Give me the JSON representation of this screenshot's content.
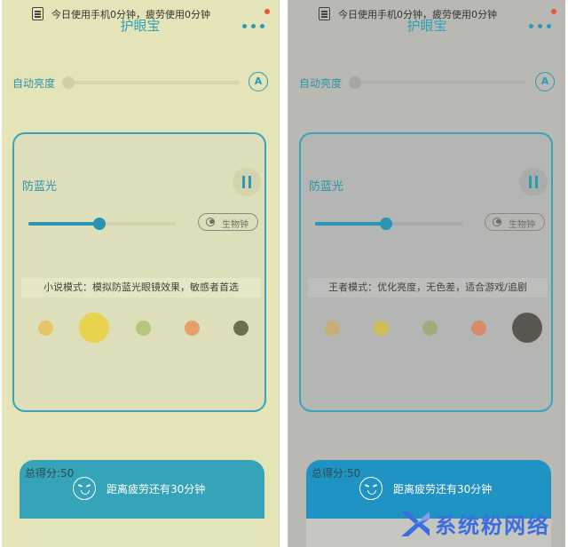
{
  "screens": [
    {
      "id": "left",
      "title": "护眼宝",
      "auto_brightness_label": "自动亮度",
      "auto_button": "A",
      "card_title": "防蓝光",
      "blue_light_level": 0.48,
      "circadian_label": "生物钟",
      "mode_text": "小说模式：模拟防蓝光眼镜效果，敏感者首选",
      "selected_dot": 1,
      "score": "总得分:50",
      "fatigue_text": "距离疲劳还有30分钟",
      "usage_text": "今日使用手机0分钟，疲劳使用0分钟"
    },
    {
      "id": "right",
      "title": "护眼宝",
      "auto_brightness_label": "自动亮度",
      "auto_button": "A",
      "card_title": "防蓝光",
      "blue_light_level": 0.48,
      "circadian_label": "生物钟",
      "mode_text": "王者模式：优化亮度，无色差，适合游戏/追剧",
      "selected_dot": 4,
      "score": "总得分:50",
      "fatigue_text": "距离疲劳还有30分钟",
      "usage_text": "今日使用手机0分钟，疲劳使用0分钟"
    }
  ],
  "dot_colors": {
    "left": [
      "#e6c46a",
      "#e8d24e",
      "#b6c67a",
      "#e6a06a",
      "#6e6e4a"
    ],
    "right": [
      "#c8ad78",
      "#cfbf52",
      "#9fab7c",
      "#d88a6a",
      "#5a5650"
    ]
  },
  "accent_color": "#2a9bb2",
  "watermark": {
    "text": "系统粉网络"
  }
}
